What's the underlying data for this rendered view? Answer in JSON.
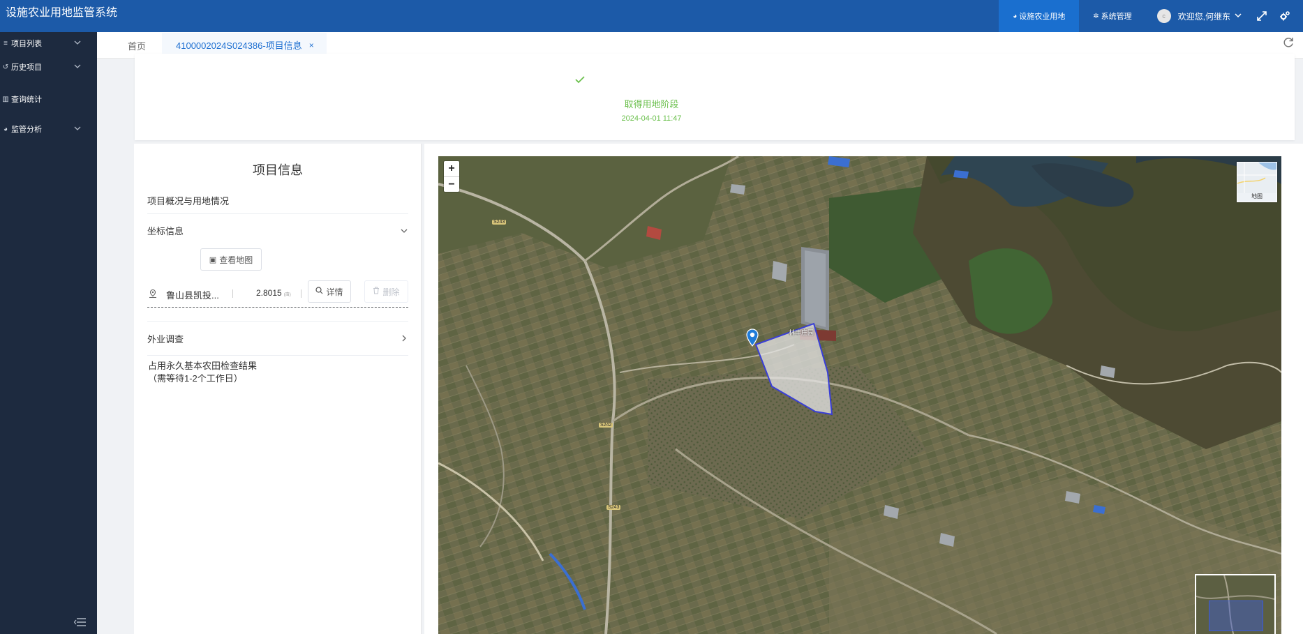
{
  "app": {
    "title": "设施农业用地监管系统"
  },
  "topnav": {
    "items": [
      {
        "label": "设施农业用地",
        "icon": "pie-chart-icon",
        "active": true
      },
      {
        "label": "系统管理",
        "icon": "gears-icon",
        "active": false
      }
    ],
    "user_greeting": "欢迎您,何继东",
    "avatar_initial": "c"
  },
  "sidebar": {
    "items": [
      {
        "label": "项目列表",
        "icon": "list-icon",
        "has_submenu": true
      },
      {
        "label": "历史项目",
        "icon": "history-icon",
        "has_submenu": true
      },
      {
        "label": "查询统计",
        "icon": "bar-chart-icon",
        "has_submenu": false
      },
      {
        "label": "监管分析",
        "icon": "pie-chart-icon",
        "has_submenu": true
      }
    ]
  },
  "tabs": {
    "home": "首页",
    "active": "4100002024S024386-项目信息",
    "close_glyph": "×"
  },
  "stage": {
    "name": "取得用地阶段",
    "time": "2024-04-01 11:47",
    "status_color": "#6bc04d"
  },
  "project": {
    "title": "项目信息",
    "overview_label": "项目概况与用地情况",
    "coord_label": "坐标信息",
    "view_map_button": "查看地图",
    "coord_row": {
      "name": "鲁山县凯投...",
      "area": "2.8015",
      "unit": "(亩)",
      "detail_button": "详情",
      "delete_button": "删除"
    },
    "field_survey_label": "外业调查",
    "farmland_result_line1": "占用永久基本农田检查结果",
    "farmland_result_line2": "（需等待1-2个工作日）"
  },
  "map": {
    "zoom_in": "+",
    "zoom_out": "−",
    "layer_label": "地图",
    "place_label": "林丰庄园",
    "road_labels": [
      "S243",
      "S242",
      "S243"
    ],
    "parcel_outline_color": "#3a3fd6"
  }
}
